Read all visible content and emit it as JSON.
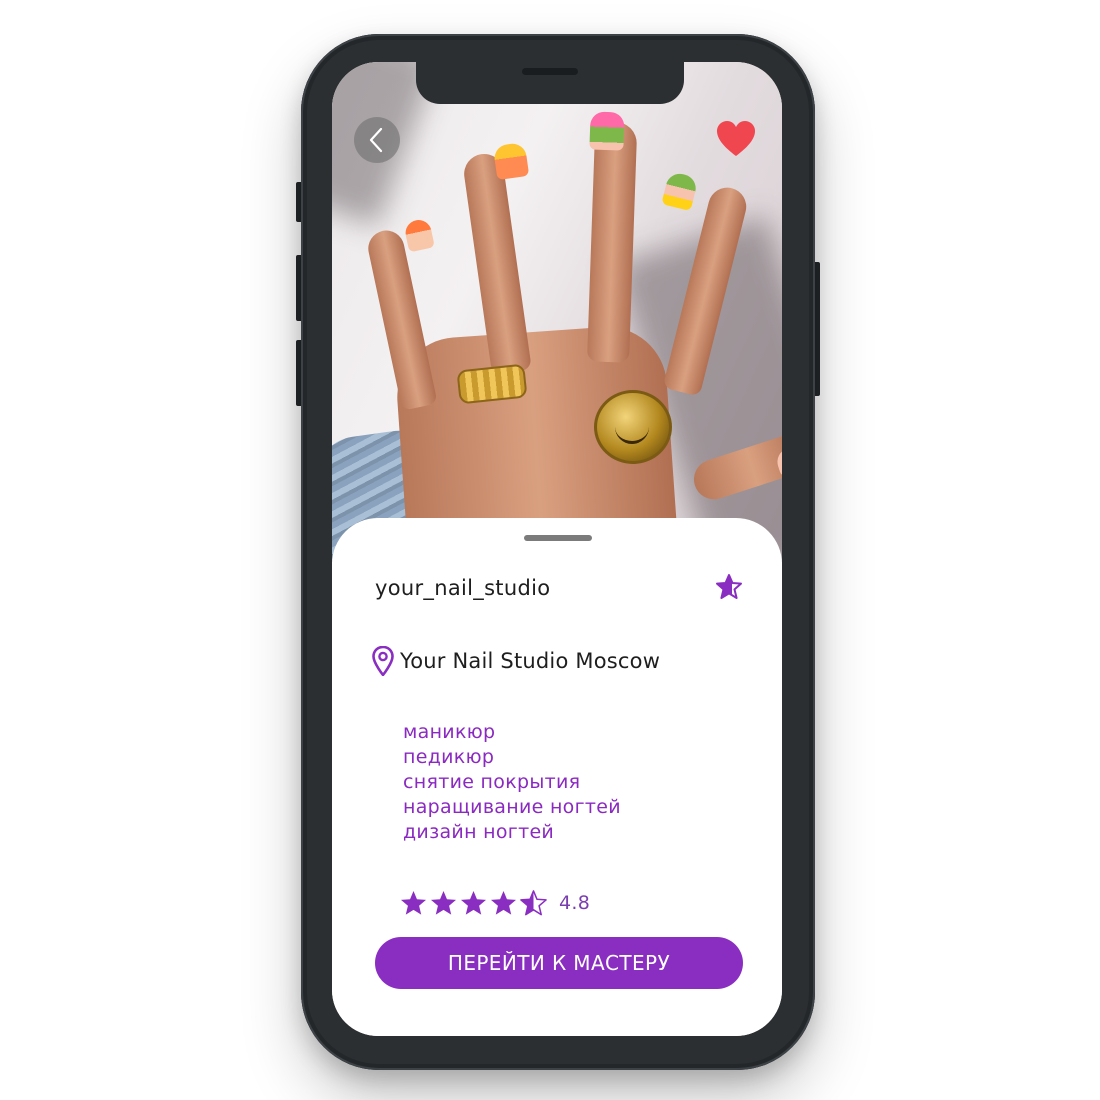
{
  "header": {
    "back_icon": "chevron-left-icon",
    "favorite_icon": "heart-icon",
    "favorite_color": "#f0464f"
  },
  "profile": {
    "username": "your_nail_studio",
    "bookmark_icon": "star-icon",
    "location_icon": "location-pin-icon",
    "location": "Your Nail Studio Moscow",
    "services": [
      "маникюр",
      "педикюр",
      "снятие покрытия",
      "наращивание ногтей",
      "дизайн ногтей"
    ],
    "rating": {
      "value": "4.8",
      "stars_max": 5,
      "stars_filled": 4.5
    },
    "cta_label": "ПЕРЕЙТИ К МАСТЕРУ"
  },
  "colors": {
    "accent": "#8a2ec2",
    "service_text": "#8a2ac0",
    "phone_body": "#2b2f32"
  }
}
